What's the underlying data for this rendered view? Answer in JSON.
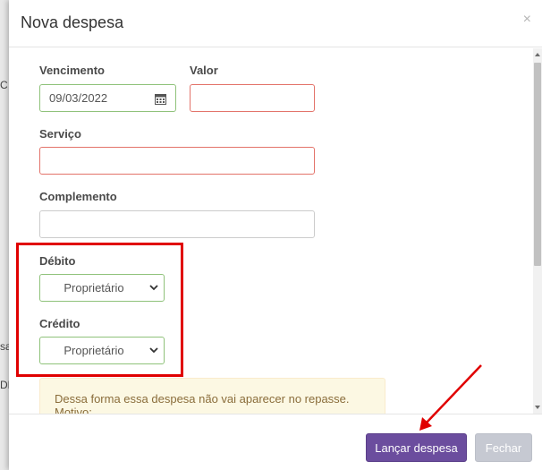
{
  "background": {
    "snippets": [
      "C",
      "sa",
      "DE"
    ]
  },
  "modal": {
    "title": "Nova despesa",
    "close_label": "×"
  },
  "form": {
    "vencimento": {
      "label": "Vencimento",
      "value": "09/03/2022"
    },
    "valor": {
      "label": "Valor",
      "value": ""
    },
    "servico": {
      "label": "Serviço",
      "value": ""
    },
    "complemento": {
      "label": "Complemento",
      "value": ""
    },
    "debito": {
      "label": "Débito",
      "selected": "Proprietário"
    },
    "credito": {
      "label": "Crédito",
      "selected": "Proprietário"
    }
  },
  "alert": {
    "text": "Dessa forma essa despesa não vai aparecer no repasse. Motivo:"
  },
  "footer": {
    "submit_label": "Lançar despesa",
    "close_label": "Fechar"
  },
  "colors": {
    "primary": "#6b4d9e",
    "valid_border": "#8fc27a",
    "error_border": "#e3736a",
    "annotation_red": "#e00000",
    "alert_bg": "#fcf8e3"
  }
}
